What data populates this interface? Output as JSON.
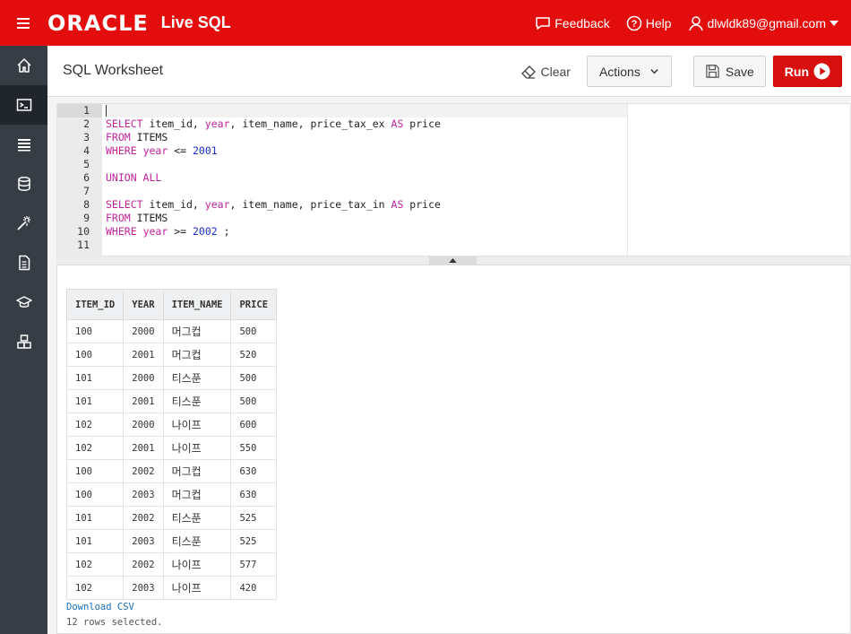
{
  "app": {
    "logo": "ORACLE",
    "product": "Live SQL"
  },
  "topbar": {
    "feedback": "Feedback",
    "help": "Help",
    "user": "dlwldk89@gmail.com"
  },
  "header": {
    "title": "SQL Worksheet",
    "clear": "Clear",
    "actions": "Actions",
    "save": "Save",
    "run": "Run"
  },
  "editor": {
    "line_numbers": [
      "1",
      "2",
      "3",
      "4",
      "5",
      "6",
      "7",
      "8",
      "9",
      "10",
      "11"
    ],
    "active_line": 1
  },
  "results": {
    "columns": [
      "ITEM_ID",
      "YEAR",
      "ITEM_NAME",
      "PRICE"
    ],
    "rows": [
      [
        "100",
        "2000",
        "머그컵",
        "500"
      ],
      [
        "100",
        "2001",
        "머그컵",
        "520"
      ],
      [
        "101",
        "2000",
        "티스푼",
        "500"
      ],
      [
        "101",
        "2001",
        "티스푼",
        "500"
      ],
      [
        "102",
        "2000",
        "나이프",
        "600"
      ],
      [
        "102",
        "2001",
        "나이프",
        "550"
      ],
      [
        "100",
        "2002",
        "머그컵",
        "630"
      ],
      [
        "100",
        "2003",
        "머그컵",
        "630"
      ],
      [
        "101",
        "2002",
        "티스푼",
        "525"
      ],
      [
        "101",
        "2003",
        "티스푼",
        "525"
      ],
      [
        "102",
        "2002",
        "나이프",
        "577"
      ],
      [
        "102",
        "2003",
        "나이프",
        "420"
      ]
    ],
    "download": "Download CSV",
    "status": "12 rows selected."
  },
  "colors": {
    "brand": "#e40d0d",
    "nav": "#363d45",
    "keyword": "#c0229e",
    "number": "#1b2fcf"
  },
  "code": {
    "l1": "",
    "l2_kw1": "SELECT",
    "l2_a": " item_id, ",
    "l2_kw2": "year",
    "l2_b": ", item_name, price_tax_ex ",
    "l2_kw3": "AS",
    "l2_c": " price",
    "l3_kw": "FROM",
    "l3_a": " ITEMS",
    "l4_kw1": "WHERE",
    "l4_a": " ",
    "l4_kw2": "year",
    "l4_b": " <= ",
    "l4_num": "2001",
    "l6_kw": "UNION ALL",
    "l8_kw1": "SELECT",
    "l8_a": " item_id, ",
    "l8_kw2": "year",
    "l8_b": ", item_name, price_tax_in ",
    "l8_kw3": "AS",
    "l8_c": " price",
    "l9_kw": "FROM",
    "l9_a": " ITEMS",
    "l10_kw1": "WHERE",
    "l10_a": " ",
    "l10_kw2": "year",
    "l10_b": " >= ",
    "l10_num": "2002",
    "l10_c": " ;"
  }
}
